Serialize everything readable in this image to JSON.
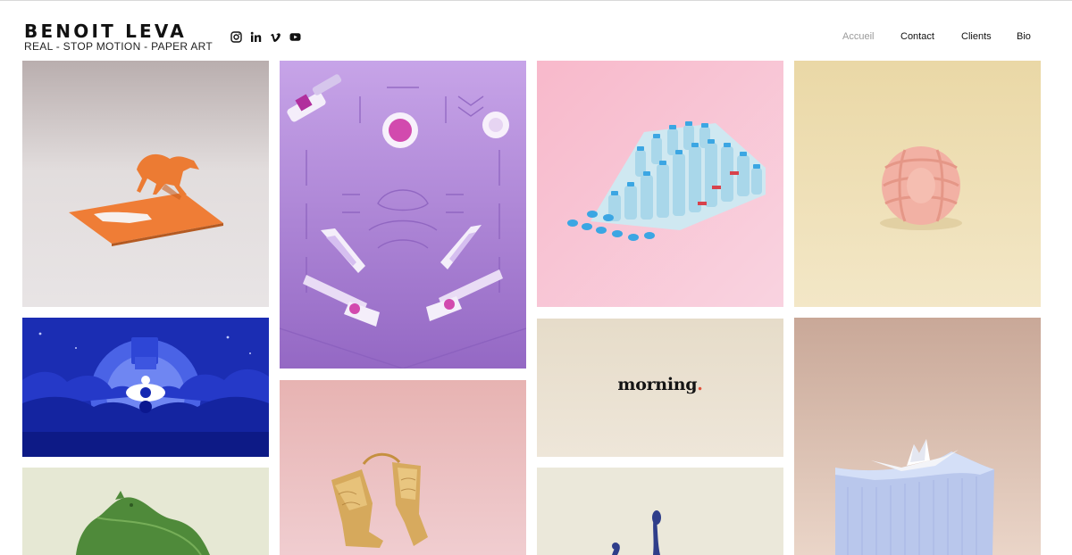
{
  "header": {
    "brand_name": "BENOIT LEVA",
    "brand_tagline": "REAL - STOP MOTION - PAPER ART"
  },
  "social": [
    {
      "name": "instagram-icon"
    },
    {
      "name": "linkedin-icon"
    },
    {
      "name": "vimeo-icon"
    },
    {
      "name": "youtube-icon"
    }
  ],
  "nav": {
    "items": [
      {
        "label": "Accueil",
        "active": true
      },
      {
        "label": "Contact",
        "active": false
      },
      {
        "label": "Clients",
        "active": false
      },
      {
        "label": "Bio",
        "active": false
      }
    ]
  },
  "gallery": {
    "items": [
      {
        "name": "paper-horse",
        "bg": "#dfd9d9"
      },
      {
        "name": "paper-pinball",
        "bg": "#a784d2"
      },
      {
        "name": "water-bottles",
        "bg": "#f6c8d7"
      },
      {
        "name": "pink-knot",
        "bg": "#eedfb8"
      },
      {
        "name": "night-scene",
        "bg": "#1b2fb5"
      },
      {
        "name": "morning-card",
        "bg": "#ece3d4",
        "text": "morning",
        "dot": "."
      },
      {
        "name": "paper-boat",
        "bg": "#d7b9a6"
      },
      {
        "name": "leaf-panther",
        "bg": "#e7ead6"
      },
      {
        "name": "golden-boots",
        "bg": "#ecc2c4"
      },
      {
        "name": "blue-splash",
        "bg": "#e9e6d7"
      }
    ]
  }
}
